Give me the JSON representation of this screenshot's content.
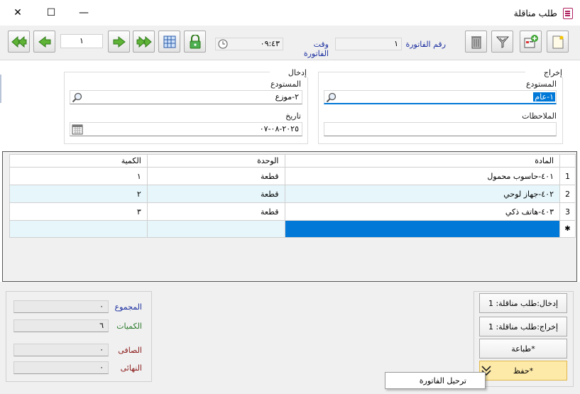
{
  "window": {
    "title": "طلب مناقلة",
    "close_glyph": "✕",
    "maximize_glyph": "☐",
    "minimize_glyph": "—"
  },
  "toolbar": {
    "page_number": "١",
    "invoice_number_label": "رقم الفاتورة",
    "invoice_number_value": "١",
    "invoice_time_label": "وقت الفاتورة",
    "invoice_time_value": "٠٩:٤٣"
  },
  "form": {
    "output_group_title": "إخراج",
    "output_warehouse_label": "المستودع",
    "output_warehouse_value": "١-عام",
    "notes_label": "الملاحظات",
    "notes_value": "",
    "input_group_title": "إدخال",
    "input_warehouse_label": "المستودع",
    "input_warehouse_value": "٢-موزع",
    "date_label": "تاريخ",
    "date_value": "٢٠٢٥-٠٨-٠٧"
  },
  "grid": {
    "headers": {
      "material": "المادة",
      "unit": "الوحدة",
      "quantity": "الكمية"
    },
    "rows": [
      {
        "index": "1",
        "material": "٤٠١-حاسوب محمول",
        "unit": "قطعة",
        "quantity": "١"
      },
      {
        "index": "2",
        "material": "٤٠٢-جهاز لوحي",
        "unit": "قطعة",
        "quantity": "٢"
      },
      {
        "index": "3",
        "material": "٤٠٣-هاتف ذكي",
        "unit": "قطعة",
        "quantity": "٣"
      }
    ],
    "new_row_marker": "✱"
  },
  "actions": {
    "input_transfer": "إدخال:طلب مناقلة: 1",
    "output_transfer": "إخراج:طلب مناقلة: 1",
    "print": "طباعة*",
    "save": "حفظ*",
    "dropdown_item": "ترحيل الفاتورة"
  },
  "totals": {
    "total_label": "المجموع",
    "total_value": "٠",
    "quantities_label": "الكميات",
    "quantities_value": "٦",
    "net_label": "الصافى",
    "net_value": "٠",
    "final_label": "النهائى",
    "final_value": "٠"
  },
  "colors": {
    "accent_blue": "#0078d7",
    "label_blue": "#1c2fa0",
    "label_green": "#2a7a2a",
    "label_red": "#8b1a1a",
    "save_highlight": "#fde9a8",
    "row_alt": "#e6f6fb"
  }
}
